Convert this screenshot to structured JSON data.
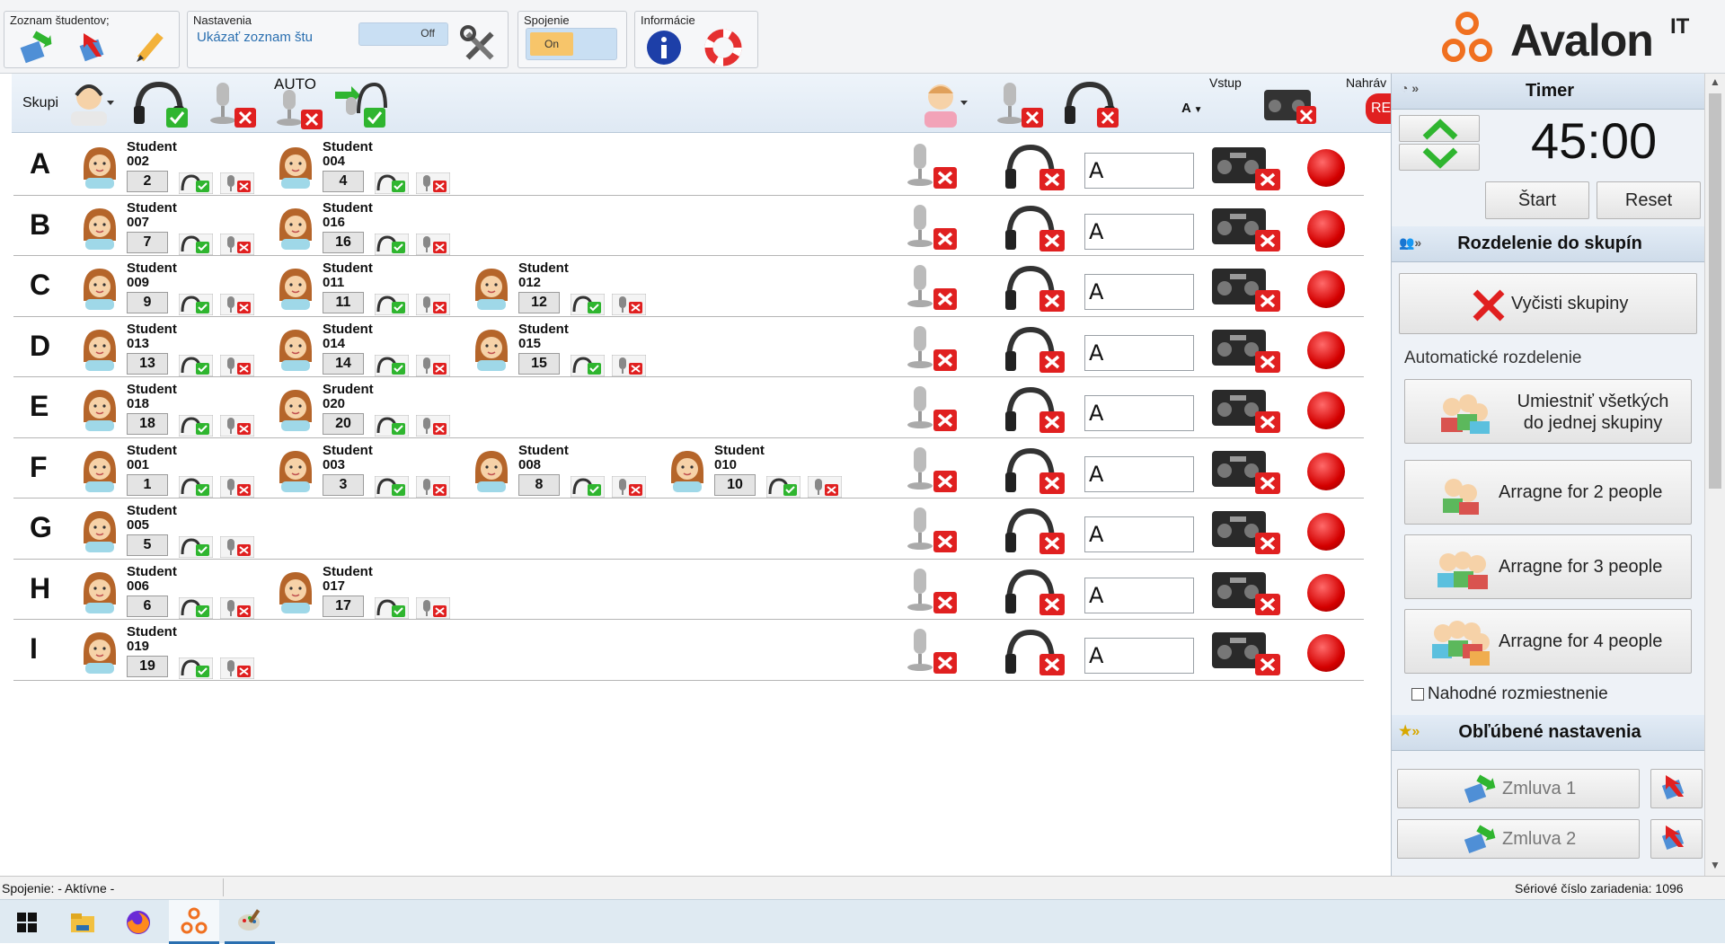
{
  "ribbon": {
    "student_list_title": "Zoznam študentov;",
    "settings_title": "Nastavenia",
    "show_list_label": "Ukázať zoznam štu",
    "off_label": "Off",
    "connection_title": "Spojenie",
    "on_label": "On",
    "info_title": "Informácie",
    "brand": "Avalon",
    "brand_sup": "IT"
  },
  "toolbar": {
    "groups_label": "Skupi",
    "auto_label": "AUTO",
    "input_label": "Vstup",
    "input_value": "A",
    "record_label": "Nahráv",
    "rec_badge": "RE"
  },
  "rows": [
    {
      "letter": "A",
      "input": "A",
      "students": [
        {
          "name": "Student",
          "id": "002",
          "num": "2"
        },
        {
          "name": "Student",
          "id": "004",
          "num": "4"
        }
      ]
    },
    {
      "letter": "B",
      "input": "A",
      "students": [
        {
          "name": "Student",
          "id": "007",
          "num": "7"
        },
        {
          "name": "Student",
          "id": "016",
          "num": "16"
        }
      ]
    },
    {
      "letter": "C",
      "input": "A",
      "students": [
        {
          "name": "Student",
          "id": "009",
          "num": "9"
        },
        {
          "name": "Student",
          "id": "011",
          "num": "11"
        },
        {
          "name": "Student",
          "id": "012",
          "num": "12"
        }
      ]
    },
    {
      "letter": "D",
      "input": "A",
      "students": [
        {
          "name": "Student",
          "id": "013",
          "num": "13"
        },
        {
          "name": "Student",
          "id": "014",
          "num": "14"
        },
        {
          "name": "Student",
          "id": "015",
          "num": "15"
        }
      ]
    },
    {
      "letter": "E",
      "input": "A",
      "students": [
        {
          "name": "Student",
          "id": "018",
          "num": "18"
        },
        {
          "name": "Srudent",
          "id": "020",
          "num": "20"
        }
      ]
    },
    {
      "letter": "F",
      "input": "A",
      "students": [
        {
          "name": "Student",
          "id": "001",
          "num": "1"
        },
        {
          "name": "Student",
          "id": "003",
          "num": "3"
        },
        {
          "name": "Student",
          "id": "008",
          "num": "8"
        },
        {
          "name": "Student",
          "id": "010",
          "num": "10"
        }
      ]
    },
    {
      "letter": "G",
      "input": "A",
      "students": [
        {
          "name": "Student",
          "id": "005",
          "num": "5"
        }
      ]
    },
    {
      "letter": "H",
      "input": "A",
      "students": [
        {
          "name": "Student",
          "id": "006",
          "num": "6"
        },
        {
          "name": "Student",
          "id": "017",
          "num": "17"
        }
      ]
    },
    {
      "letter": "I",
      "input": "A",
      "students": [
        {
          "name": "Student",
          "id": "019",
          "num": "19"
        }
      ]
    }
  ],
  "timer": {
    "title": "Timer",
    "value": "45:00",
    "start": "Štart",
    "reset": "Reset"
  },
  "groups_panel": {
    "title": "Rozdelenie do skupín",
    "clear": "Vyčisti skupiny",
    "auto_title": "Automatické rozdelenie",
    "all_one_line1": "Umiestniť všetkých",
    "all_one_line2": "do jednej skupiny",
    "arr2": "Arragne for 2 people",
    "arr3": "Arragne for 3 people",
    "arr4": "Arragne for 4 people",
    "random": "Nahodné rozmiestnenie"
  },
  "fav_panel": {
    "title": "Obľúbené nastavenia",
    "z1": "Zmluva 1",
    "z2": "Zmluva 2"
  },
  "status": {
    "left": "Spojenie: - Aktívne -",
    "right": "Sériové číslo zariadenia: 1096"
  },
  "colors": {
    "accent": "#2a6fb0",
    "red": "#e02020",
    "green": "#2fb52f"
  }
}
